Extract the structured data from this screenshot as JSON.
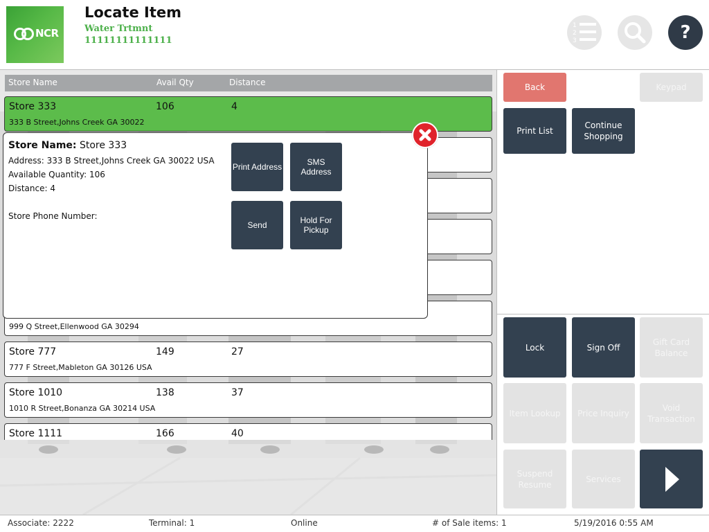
{
  "header": {
    "logo_text": "NCR",
    "title": "Locate Item",
    "item_name": "Water Trtmnt",
    "item_code": "11111111111111",
    "help_label": "?"
  },
  "list": {
    "columns": [
      "Store Name",
      "Avail Qty",
      "Distance"
    ],
    "rows": [
      {
        "name": "Store 333",
        "qty": "106",
        "distance": "4",
        "address": "333 B Street,Johns Creek GA 30022",
        "selected": true
      },
      {
        "name": "",
        "qty": "",
        "distance": "",
        "address": ""
      },
      {
        "name": "",
        "qty": "",
        "distance": "",
        "address": ""
      },
      {
        "name": "",
        "qty": "",
        "distance": "",
        "address": ""
      },
      {
        "name": "",
        "qty": "",
        "distance": "",
        "address": ""
      },
      {
        "name": "",
        "qty": "",
        "distance": "",
        "address": "999 Q Street,Ellenwood GA 30294"
      },
      {
        "name": "Store 777",
        "qty": "149",
        "distance": "27",
        "address": "777 F Street,Mableton GA 30126 USA"
      },
      {
        "name": "Store 1010",
        "qty": "138",
        "distance": "37",
        "address": "1010 R Street,Bonanza GA 30214 USA"
      },
      {
        "name": "Store 1111",
        "qty": "166",
        "distance": "40",
        "address": ""
      }
    ]
  },
  "popup": {
    "store_name_label": "Store Name:",
    "store_name_value": "Store 333",
    "address": "Address: 333 B Street,Johns Creek GA 30022 USA",
    "quantity": "Available Quantity: 106",
    "distance": "Distance: 4",
    "phone": "Store Phone Number:",
    "buttons": {
      "print_address": "Print Address",
      "sms_address": "SMS Address",
      "send": "Send",
      "hold_for_pickup": "Hold For Pickup"
    }
  },
  "right": {
    "back": "Back",
    "keypad": "Keypad",
    "print_list": "Print List",
    "continue_shopping": "Continue Shopping",
    "lock": "Lock",
    "sign_off": "Sign Off",
    "gift_card_balance": "Gift Card Balance",
    "item_lookup": "Item Lookup",
    "price_inquiry": "Price Inquiry",
    "void_transaction": "Void Transaction",
    "suspend_resume": "Suspend Resume",
    "services": "Services"
  },
  "status": {
    "associate": "Associate: 2222",
    "terminal": "Terminal: 1",
    "online": "Online",
    "sale_items": "# of Sale items: 1",
    "datetime": "5/19/2016 0:55 AM"
  },
  "colors": {
    "selected_row": "#5cbc4b",
    "dark_button": "#334150",
    "back_button": "#e1766f",
    "close_button": "#e0232b",
    "item_text": "#4cb04a"
  },
  "icons": [
    "ncr-logo-icon",
    "numbered-list-icon",
    "search-icon",
    "help-icon",
    "close-icon",
    "arrow-right-icon"
  ]
}
